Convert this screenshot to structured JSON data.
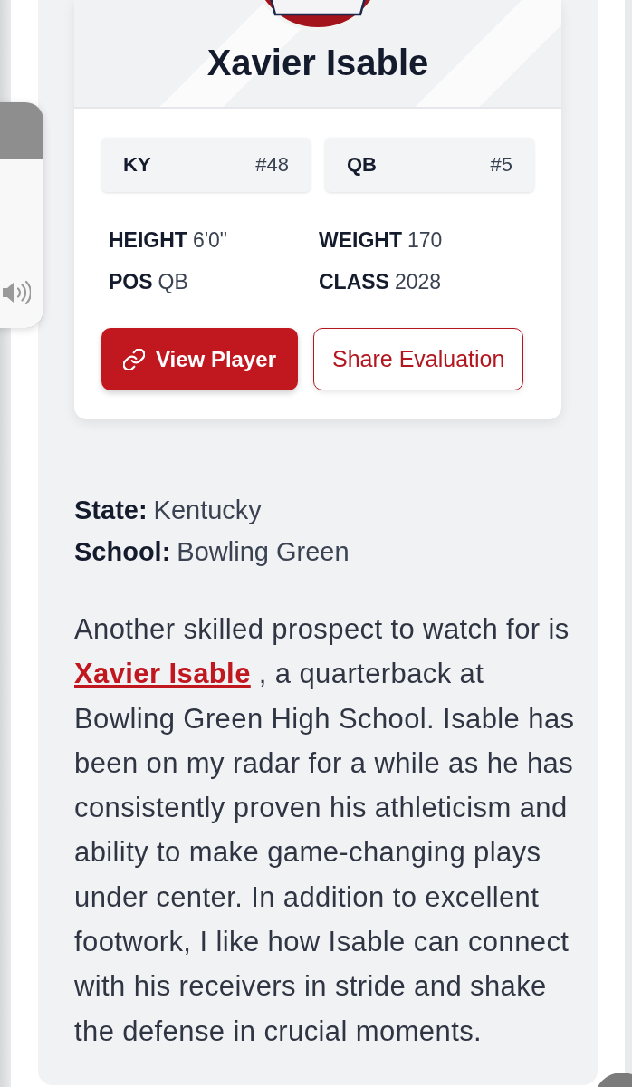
{
  "system_overlay": {
    "volume_slider": {
      "level": 0.75
    }
  },
  "player_card": {
    "name": "Xavier Isable",
    "rankings": [
      {
        "label": "KY",
        "rank": "#48"
      },
      {
        "label": "QB",
        "rank": "#5"
      }
    ],
    "stats": [
      {
        "label": "HEIGHT",
        "value": "6'0\""
      },
      {
        "label": "WEIGHT",
        "value": "170"
      },
      {
        "label": "POS",
        "value": "QB"
      },
      {
        "label": "CLASS",
        "value": "2028"
      }
    ],
    "buttons": [
      {
        "label": "View Player",
        "kind": "primary"
      },
      {
        "label": "Share Evaluation",
        "kind": "outline"
      }
    ]
  },
  "details": [
    {
      "label": "State:",
      "value": "Kentucky"
    },
    {
      "label": "School:",
      "value": "Bowling Green"
    }
  ],
  "paragraph": [
    {
      "kind": "text",
      "text": "Another skilled prospect to watch for is "
    },
    {
      "kind": "link",
      "text": "Xavier Isable"
    },
    {
      "kind": "text",
      "text": " , a quarterback at Bowling Green High School. Isable has been on my radar for a while as he has consistently proven his athleticism and ability to make game-changing plays under center. In addition to excellent footwork, I like how Isable can connect with his receivers in stride and shake the defense in crucial moments."
    }
  ]
}
